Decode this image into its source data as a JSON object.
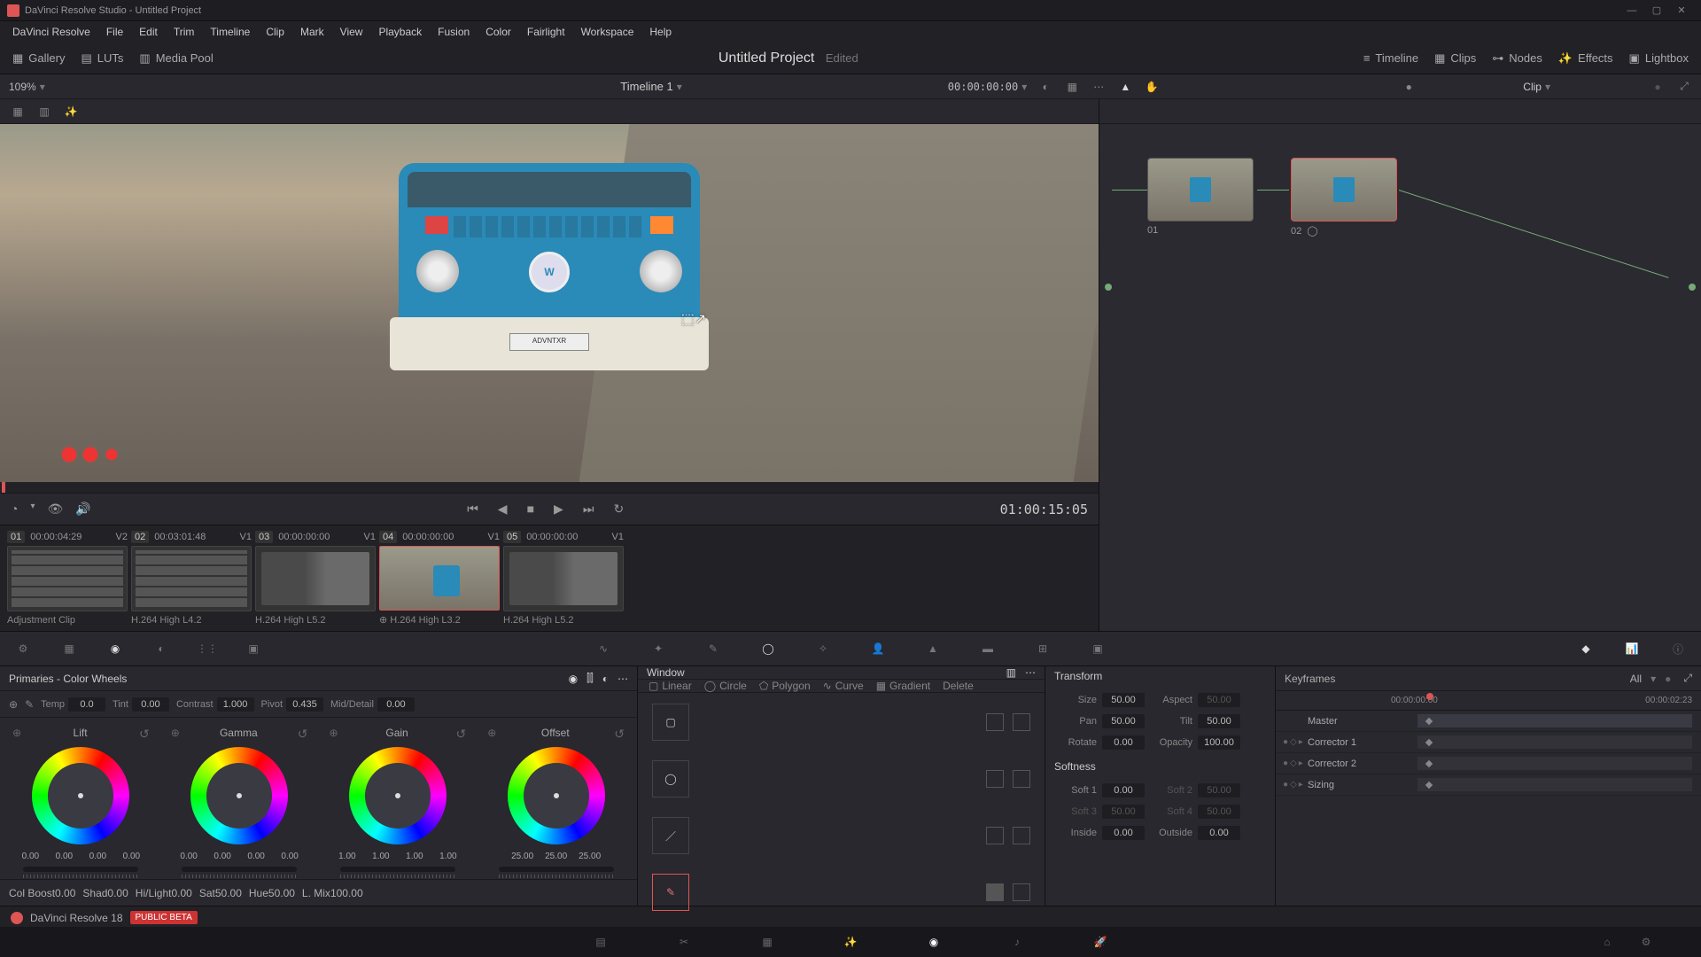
{
  "app": {
    "title": "DaVinci Resolve Studio - Untitled Project",
    "product": "DaVinci Resolve 18",
    "beta": "PUBLIC BETA"
  },
  "menu": [
    "DaVinci Resolve",
    "File",
    "Edit",
    "Trim",
    "Timeline",
    "Clip",
    "Mark",
    "View",
    "Playback",
    "Fusion",
    "Color",
    "Fairlight",
    "Workspace",
    "Help"
  ],
  "topbar": {
    "left": [
      "Gallery",
      "LUTs",
      "Media Pool"
    ],
    "center_title": "Untitled Project",
    "center_status": "Edited",
    "right": [
      "Timeline",
      "Clips",
      "Nodes",
      "Effects",
      "Lightbox"
    ]
  },
  "subbar": {
    "zoom": "109%",
    "timeline_name": "Timeline 1",
    "timecode": "00:00:00:00",
    "node_mode": "Clip"
  },
  "transport": {
    "tc": "01:00:15:05"
  },
  "clips": [
    {
      "num": "01",
      "tc": "00:00:04:29",
      "track": "V2",
      "label": "Adjustment Clip",
      "kind": "grid"
    },
    {
      "num": "02",
      "tc": "00:03:01:48",
      "track": "V1",
      "label": "H.264 High L4.2",
      "kind": "grid"
    },
    {
      "num": "03",
      "tc": "00:00:00:00",
      "track": "V1",
      "label": "H.264 High L5.2",
      "kind": "men"
    },
    {
      "num": "04",
      "tc": "00:00:00:00",
      "track": "V1",
      "label": "H.264 High L3.2",
      "kind": "van",
      "sel": true
    },
    {
      "num": "05",
      "tc": "00:00:00:00",
      "track": "V1",
      "label": "H.264 High L5.2",
      "kind": "men"
    }
  ],
  "nodes": [
    {
      "id": "01"
    },
    {
      "id": "02",
      "sel": true
    }
  ],
  "primaries": {
    "title": "Primaries - Color Wheels",
    "top_params": [
      {
        "label": "Temp",
        "value": "0.0"
      },
      {
        "label": "Tint",
        "value": "0.00"
      },
      {
        "label": "Contrast",
        "value": "1.000"
      },
      {
        "label": "Pivot",
        "value": "0.435"
      },
      {
        "label": "Mid/Detail",
        "value": "0.00"
      }
    ],
    "wheels": [
      {
        "name": "Lift",
        "vals": [
          "0.00",
          "0.00",
          "0.00",
          "0.00"
        ]
      },
      {
        "name": "Gamma",
        "vals": [
          "0.00",
          "0.00",
          "0.00",
          "0.00"
        ]
      },
      {
        "name": "Gain",
        "vals": [
          "1.00",
          "1.00",
          "1.00",
          "1.00"
        ]
      },
      {
        "name": "Offset",
        "vals": [
          "25.00",
          "25.00",
          "25.00"
        ]
      }
    ],
    "bottom_params": [
      {
        "label": "Col Boost",
        "value": "0.00"
      },
      {
        "label": "Shad",
        "value": "0.00"
      },
      {
        "label": "Hi/Light",
        "value": "0.00"
      },
      {
        "label": "Sat",
        "value": "50.00"
      },
      {
        "label": "Hue",
        "value": "50.00"
      },
      {
        "label": "L. Mix",
        "value": "100.00"
      }
    ]
  },
  "window": {
    "title": "Window",
    "tools": [
      "Linear",
      "Circle",
      "Polygon",
      "Curve",
      "Gradient",
      "Delete"
    ]
  },
  "transform": {
    "title": "Transform",
    "rows": [
      [
        {
          "label": "Size",
          "value": "50.00"
        },
        {
          "label": "Aspect",
          "value": "50.00",
          "dim": true
        }
      ],
      [
        {
          "label": "Pan",
          "value": "50.00"
        },
        {
          "label": "Tilt",
          "value": "50.00"
        }
      ],
      [
        {
          "label": "Rotate",
          "value": "0.00"
        },
        {
          "label": "Opacity",
          "value": "100.00"
        }
      ]
    ],
    "softness_title": "Softness",
    "soft_rows": [
      [
        {
          "label": "Soft 1",
          "value": "0.00"
        },
        {
          "label": "Soft 2",
          "value": "50.00",
          "dim": true
        }
      ],
      [
        {
          "label": "Soft 3",
          "value": "50.00",
          "dim": true
        },
        {
          "label": "Soft 4",
          "value": "50.00",
          "dim": true
        }
      ],
      [
        {
          "label": "Inside",
          "value": "0.00"
        },
        {
          "label": "Outside",
          "value": "0.00"
        }
      ]
    ]
  },
  "keyframes": {
    "title": "Keyframes",
    "mode": "All",
    "tc_start": "00:00:00:00",
    "tc_end": "00:00:02:23",
    "tracks": [
      "Master",
      "Corrector 1",
      "Corrector 2",
      "Sizing"
    ]
  },
  "plate": "ADVNTXR"
}
